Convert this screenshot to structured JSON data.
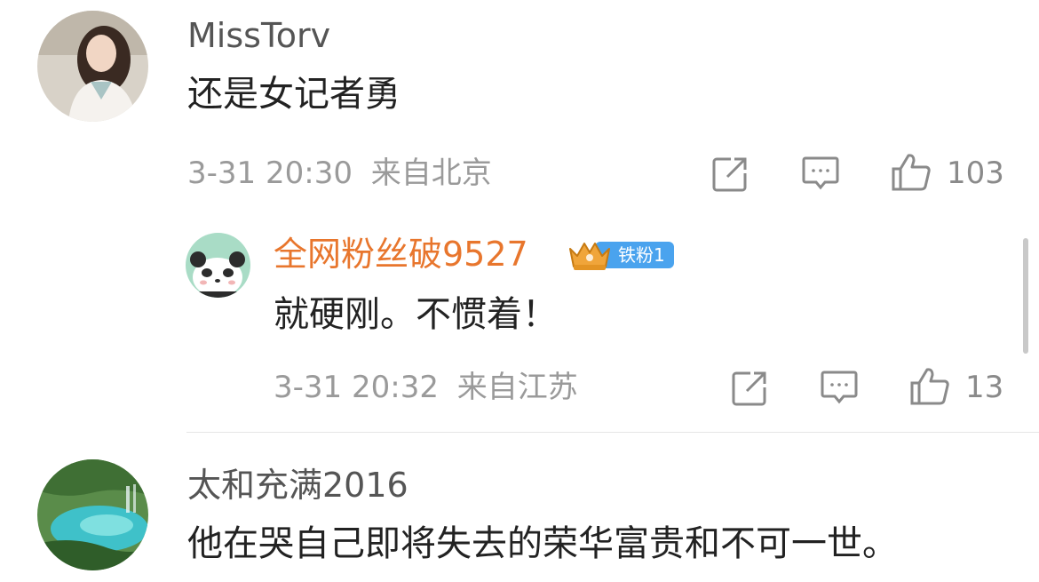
{
  "comments": [
    {
      "username": "MissTorv",
      "text": "还是女记者勇",
      "time": "3-31 20:30",
      "location": "来自北京",
      "likes": "103"
    },
    {
      "username": "全网粉丝破9527",
      "badge": "铁粉1",
      "text": "就硬刚。不惯着！",
      "time": "3-31 20:32",
      "location": "来自江苏",
      "likes": "13"
    },
    {
      "username": "太和充满2016",
      "text": "他在哭自己即将失去的荣华富贵和不可一世。"
    }
  ],
  "icons": {
    "share": "share-icon",
    "comment": "comment-icon",
    "like": "thumbs-up-icon"
  },
  "colors": {
    "reply_username": "#e8762d",
    "badge": "#4aa3ee",
    "crown": "#f0a53a"
  }
}
